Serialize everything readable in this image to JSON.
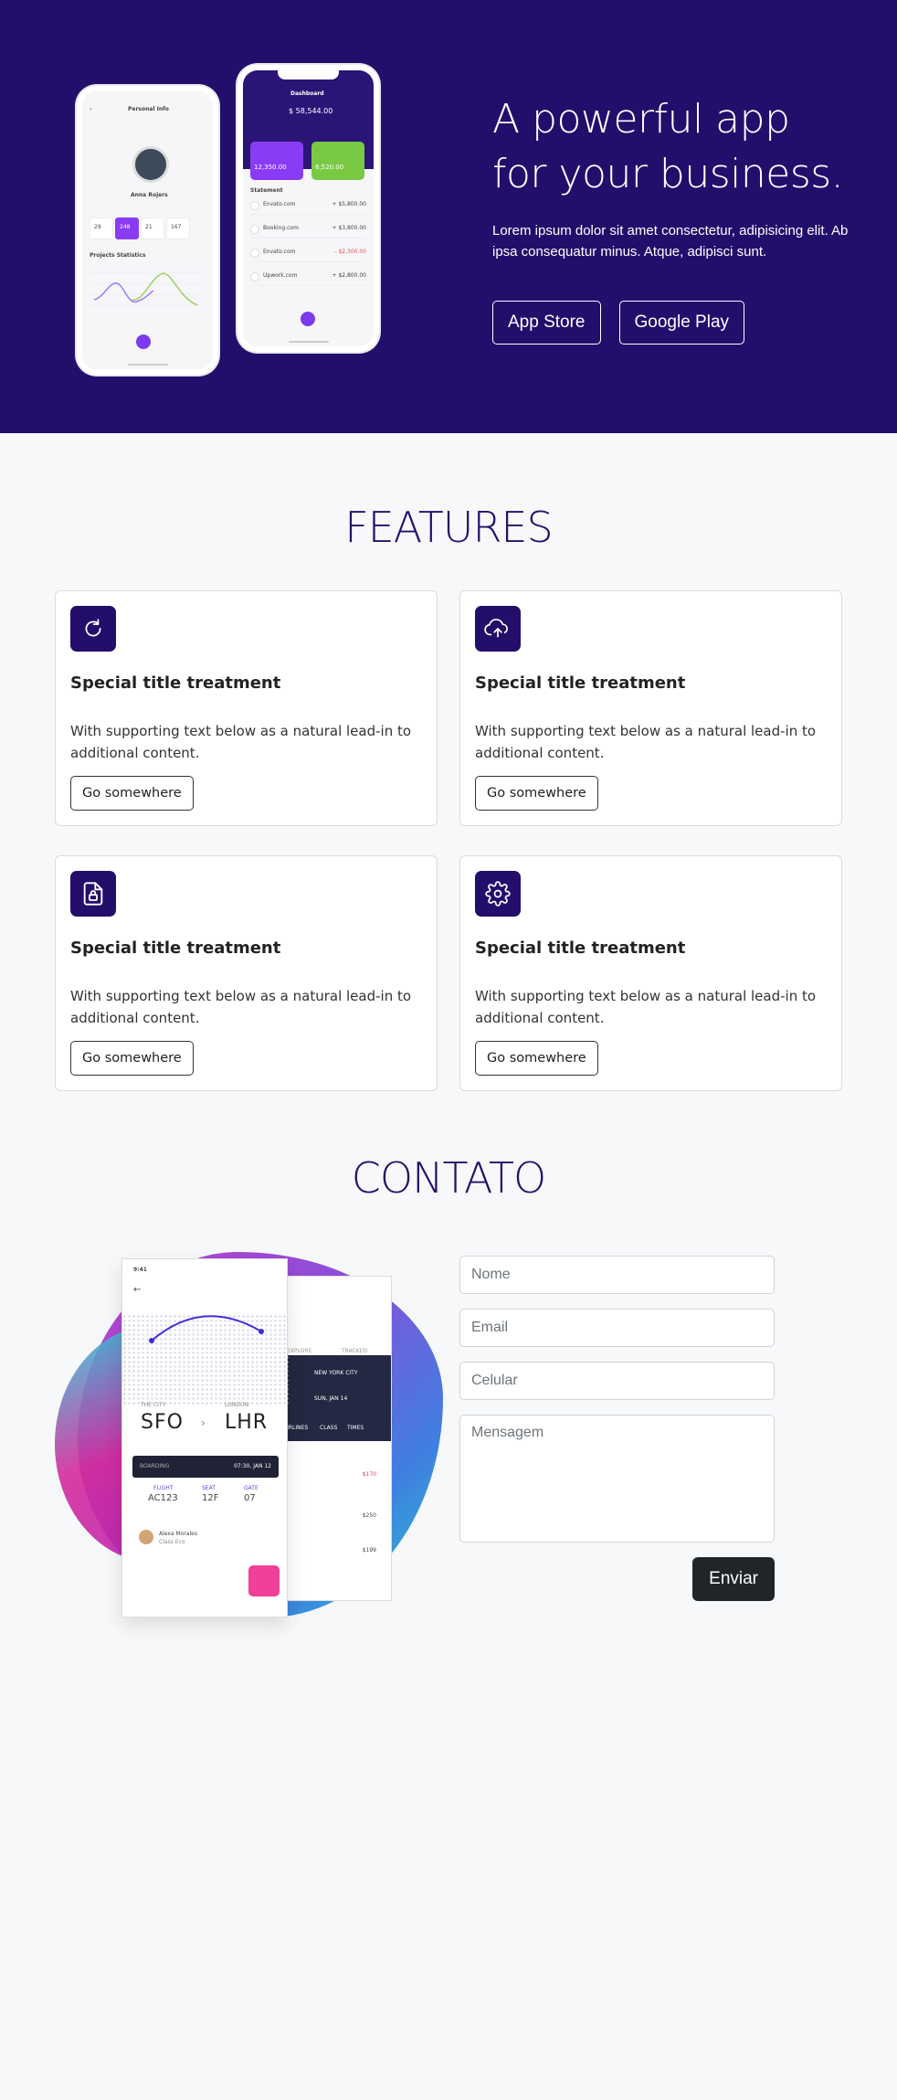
{
  "hero": {
    "title_line1": "A powerful app",
    "title_line2": "for your business.",
    "text": "Lorem ipsum dolor sit amet consectetur, adipisicing elit. Ab ipsa consequatur minus. Atque, adipisci sunt.",
    "app_store_label": "App Store",
    "google_play_label": "Google Play",
    "mockup_left": {
      "title": "Personal Info",
      "name": "Anna Rojers",
      "stats": [
        "29",
        "248",
        "21",
        "167"
      ],
      "chart_title": "Projects Statistics"
    },
    "mockup_right": {
      "title": "Dashboard",
      "balance": "$ 58,544.00",
      "card1_amount": "12,350.00",
      "card2_amount": "6,520.00",
      "statement_title": "Statement",
      "transactions": [
        {
          "name": "Envato.com",
          "amount": "+ $5,800.00"
        },
        {
          "name": "Booking.com",
          "amount": "+ $3,800.00"
        },
        {
          "name": "Envato.com",
          "amount": "- $2,300.00"
        },
        {
          "name": "Upwork.com",
          "amount": "+ $2,800.00"
        }
      ]
    }
  },
  "features": {
    "title": "FEATURES",
    "cards": [
      {
        "icon": "refresh-icon",
        "title": "Special title treatment",
        "text": "With supporting text below as a natural lead-in to additional content.",
        "button": "Go somewhere"
      },
      {
        "icon": "cloud-upload-icon",
        "title": "Special title treatment",
        "text": "With supporting text below as a natural lead-in to additional content.",
        "button": "Go somewhere"
      },
      {
        "icon": "file-lock-icon",
        "title": "Special title treatment",
        "text": "With supporting text below as a natural lead-in to additional content.",
        "button": "Go somewhere"
      },
      {
        "icon": "gear-icon",
        "title": "Special title treatment",
        "text": "With supporting text below as a natural lead-in to additional content.",
        "button": "Go somewhere"
      }
    ]
  },
  "contact": {
    "title": "CONTATO",
    "illustration": {
      "time": "9:41",
      "from_city": "THE CITY",
      "from_code": "SFO",
      "to_city": "LONDON",
      "to_code": "LHR",
      "boarding_label": "BOARDING",
      "boarding_time": "07:30, JAN 12",
      "flight_label": "FLIGHT",
      "flight_value": "AC123",
      "seat_label": "SEAT",
      "seat_value": "12F",
      "gate_label": "GATE",
      "gate_value": "07",
      "passenger_name": "Alexa Morales",
      "passenger_class": "Class Eco",
      "back_tabs": [
        "EXPLORE",
        "TRACKED"
      ],
      "back_city": "NEW YORK CITY",
      "back_date": "SUN, JAN 14",
      "back_filters": [
        "AIRLINES",
        "CLASS",
        "TIMES"
      ],
      "back_prices": [
        "$170",
        "$250",
        "$199"
      ]
    },
    "form": {
      "name_placeholder": "Nome",
      "email_placeholder": "Email",
      "phone_placeholder": "Celular",
      "message_placeholder": "Mensagem",
      "submit_label": "Enviar"
    }
  },
  "colors": {
    "brand": "#230e6b",
    "page_bg": "#f7f8fa",
    "submit_bg": "#212529"
  }
}
